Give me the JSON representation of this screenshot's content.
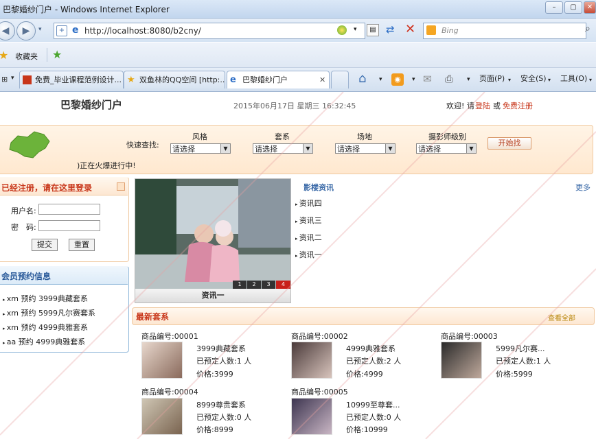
{
  "window": {
    "title": "巴黎婚纱门户 - Windows Internet Explorer",
    "url": "http://localhost:8080/b2cny/",
    "search_placeholder": "Bing"
  },
  "favorites": {
    "label": "收藏夹"
  },
  "tabs": [
    {
      "label": "免费_毕业课程范例设计..."
    },
    {
      "label": "双鱼林的QQ空间 [http:..."
    },
    {
      "label": "巴黎婚纱门户"
    }
  ],
  "commandbar": {
    "page": "页面(P)",
    "safety": "安全(S)",
    "tools": "工具(O)"
  },
  "site": {
    "title": "巴黎婚纱门户",
    "datetime": "2015年06月17日 星期三 16:32:45",
    "welcome": "欢迎! 请",
    "login": "登陆",
    "or": "或",
    "register": "免费注册",
    "hot": ")正在火爆进行中!"
  },
  "quick_search": {
    "label": "快速查找:",
    "filters": [
      {
        "label": "风格",
        "value": "请选择"
      },
      {
        "label": "套系",
        "value": "请选择"
      },
      {
        "label": "场地",
        "value": "请选择"
      },
      {
        "label": "摄影师级别",
        "value": "请选择"
      }
    ],
    "button": "开始找"
  },
  "login_panel": {
    "title": "已经注册，请在这里登录",
    "username_label": "用户名:",
    "password_label": "密　码:",
    "submit": "提交",
    "reset": "重置"
  },
  "booking_panel": {
    "title": "会员预约信息",
    "items": [
      "xm 预约 3999典藏套系",
      "xm 预约 5999凡尔赛套系",
      "xm 预约 4999典雅套系",
      "aa 预约 4999典雅套系"
    ]
  },
  "slideshow": {
    "caption": "资讯一",
    "pages": [
      "1",
      "2",
      "3",
      "4"
    ],
    "active_page": "4"
  },
  "news": {
    "title": "影楼资讯",
    "more": "更多",
    "items": [
      "资讯四",
      "资讯三",
      "资讯二",
      "资讯一"
    ]
  },
  "packages": {
    "title": "最新套系",
    "view_all": "查看全部",
    "items": [
      {
        "code": "商品编号:00001",
        "name": "3999典藏套系",
        "booked": "已预定人数:1 人",
        "price": "价格:3999"
      },
      {
        "code": "商品编号:00002",
        "name": "4999典雅套系",
        "booked": "已预定人数:2 人",
        "price": "价格:4999"
      },
      {
        "code": "商品编号:00003",
        "name": "5999凡尔赛...",
        "booked": "已预定人数:1 人",
        "price": "价格:5999"
      },
      {
        "code": "商品编号:00004",
        "name": "8999尊贵套系",
        "booked": "已预定人数:0 人",
        "price": "价格:8999"
      },
      {
        "code": "商品编号:00005",
        "name": "10999至尊套...",
        "booked": "已预定人数:0 人",
        "price": "价格:10999"
      }
    ]
  },
  "colors": {
    "accent": "#c8361a",
    "link": "#3b6aa8",
    "panel_border": "#f0c9a0",
    "ie_blue": "#d5e3f3"
  }
}
